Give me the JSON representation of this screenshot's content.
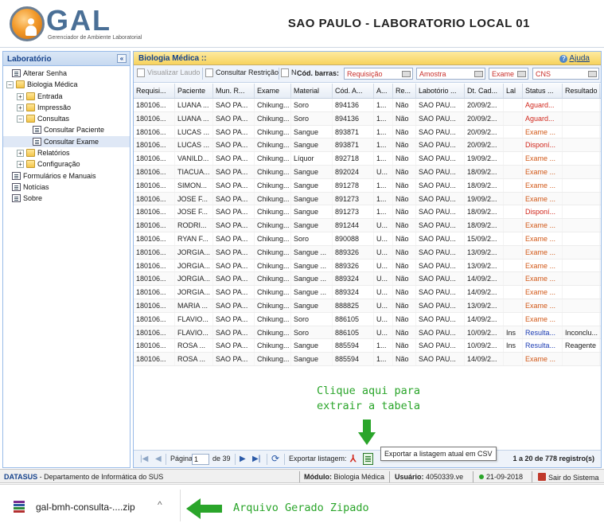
{
  "header": {
    "logo_text": "GAL",
    "logo_subtitle": "Gerenciador de Ambiente Laboratorial",
    "lab_title": "SAO PAULO - LABORATORIO LOCAL 01"
  },
  "sidebar": {
    "title": "Laboratório",
    "collapse_glyph": "«",
    "items": [
      {
        "label": "Alterar Senha",
        "icon": "document-icon",
        "level": 0,
        "expand": ""
      },
      {
        "label": "Biologia Médica",
        "icon": "folder-open-icon",
        "level": 0,
        "expand": "−"
      },
      {
        "label": "Entrada",
        "icon": "folder-icon",
        "level": 1,
        "expand": "+"
      },
      {
        "label": "Impressão",
        "icon": "folder-icon",
        "level": 1,
        "expand": "+"
      },
      {
        "label": "Consultas",
        "icon": "folder-open-icon",
        "level": 1,
        "expand": "−"
      },
      {
        "label": "Consultar Paciente",
        "icon": "document-icon",
        "level": 2,
        "expand": ""
      },
      {
        "label": "Consultar Exame",
        "icon": "document-icon",
        "level": 2,
        "expand": "",
        "selected": true
      },
      {
        "label": "Relatórios",
        "icon": "folder-icon",
        "level": 1,
        "expand": "+"
      },
      {
        "label": "Configuração",
        "icon": "folder-icon",
        "level": 1,
        "expand": "+"
      },
      {
        "label": "Formulários e Manuais",
        "icon": "document-icon",
        "level": 0,
        "expand": ""
      },
      {
        "label": "Notícias",
        "icon": "document-icon",
        "level": 0,
        "expand": ""
      },
      {
        "label": "Sobre",
        "icon": "document-icon",
        "level": 0,
        "expand": ""
      }
    ]
  },
  "main": {
    "title": "Biologia Médica ::",
    "help_label": "Ajuda",
    "help_glyph": "?",
    "toolbar": {
      "visualizar_laudo": "Visualizar Laudo",
      "consultar_restricao": "Consultar Restrição",
      "n_label": "N",
      "barcode_label": "Cód. barras:",
      "requisicao_placeholder": "Requisição",
      "amostra_placeholder": "Amostra",
      "exame_placeholder": "Exame",
      "cns_placeholder": "CNS"
    },
    "columns": [
      "Requisi...",
      "Paciente",
      "Mun. R...",
      "Exame",
      "Material",
      "Cód. A...",
      "A...",
      "Re...",
      "Labotório ...",
      "Dt. Cad...",
      "Lal",
      "Status ...",
      "Resultado"
    ],
    "rows": [
      [
        "180106...",
        "LUANA ...",
        "SAO PA...",
        "Chikung...",
        "Soro",
        "894136",
        "1...",
        "Não",
        "SAO PAU...",
        "20/09/2...",
        "",
        "Aguard...",
        "",
        "red"
      ],
      [
        "180106...",
        "LUANA ...",
        "SAO PA...",
        "Chikung...",
        "Soro",
        "894136",
        "1...",
        "Não",
        "SAO PAU...",
        "20/09/2...",
        "",
        "Aguard...",
        "",
        "red"
      ],
      [
        "180106...",
        "LUCAS ...",
        "SAO PA...",
        "Chikung...",
        "Sangue",
        "893871",
        "1...",
        "Não",
        "SAO PAU...",
        "20/09/2...",
        "",
        "Exame ...",
        "",
        "orange"
      ],
      [
        "180106...",
        "LUCAS ...",
        "SAO PA...",
        "Chikung...",
        "Sangue",
        "893871",
        "1...",
        "Não",
        "SAO PAU...",
        "20/09/2...",
        "",
        "Disponí...",
        "",
        "red"
      ],
      [
        "180106...",
        "VANILD...",
        "SAO PA...",
        "Chikung...",
        "Líquor",
        "892718",
        "1...",
        "Não",
        "SAO PAU...",
        "19/09/2...",
        "",
        "Exame ...",
        "",
        "orange"
      ],
      [
        "180106...",
        "TIACUA...",
        "SAO PA...",
        "Chikung...",
        "Sangue",
        "892024",
        "U...",
        "Não",
        "SAO PAU...",
        "18/09/2...",
        "",
        "Exame ...",
        "",
        "orange"
      ],
      [
        "180106...",
        "SIMON...",
        "SAO PA...",
        "Chikung...",
        "Sangue",
        "891278",
        "1...",
        "Não",
        "SAO PAU...",
        "18/09/2...",
        "",
        "Exame ...",
        "",
        "orange"
      ],
      [
        "180106...",
        "JOSE F...",
        "SAO PA...",
        "Chikung...",
        "Sangue",
        "891273",
        "1...",
        "Não",
        "SAO PAU...",
        "19/09/2...",
        "",
        "Exame ...",
        "",
        "orange"
      ],
      [
        "180106...",
        "JOSE F...",
        "SAO PA...",
        "Chikung...",
        "Sangue",
        "891273",
        "1...",
        "Não",
        "SAO PAU...",
        "18/09/2...",
        "",
        "Disponí...",
        "",
        "red"
      ],
      [
        "180106...",
        "RODRI...",
        "SAO PA...",
        "Chikung...",
        "Sangue",
        "891244",
        "U...",
        "Não",
        "SAO PAU...",
        "18/09/2...",
        "",
        "Exame ...",
        "",
        "orange"
      ],
      [
        "180106...",
        "RYAN F...",
        "SAO PA...",
        "Chikung...",
        "Soro",
        "890088",
        "U...",
        "Não",
        "SAO PAU...",
        "15/09/2...",
        "",
        "Exame ...",
        "",
        "orange"
      ],
      [
        "180106...",
        "JORGIA...",
        "SAO PA...",
        "Chikung...",
        "Sangue ...",
        "889326",
        "U...",
        "Não",
        "SAO PAU...",
        "13/09/2...",
        "",
        "Exame ...",
        "",
        "orange"
      ],
      [
        "180106...",
        "JORGIA...",
        "SAO PA...",
        "Chikung...",
        "Sangue ...",
        "889326",
        "U...",
        "Não",
        "SAO PAU...",
        "13/09/2...",
        "",
        "Exame ...",
        "",
        "orange"
      ],
      [
        "180106...",
        "JORGIA...",
        "SAO PA...",
        "Chikung...",
        "Sangue ...",
        "889324",
        "U...",
        "Não",
        "SAO PAU...",
        "14/09/2...",
        "",
        "Exame ...",
        "",
        "orange"
      ],
      [
        "180106...",
        "JORGIA...",
        "SAO PA...",
        "Chikung...",
        "Sangue ...",
        "889324",
        "U...",
        "Não",
        "SAO PAU...",
        "14/09/2...",
        "",
        "Exame ...",
        "",
        "orange"
      ],
      [
        "180106...",
        "MARIA ...",
        "SAO PA...",
        "Chikung...",
        "Sangue",
        "888825",
        "U...",
        "Não",
        "SAO PAU...",
        "13/09/2...",
        "",
        "Exame ...",
        "",
        "orange"
      ],
      [
        "180106...",
        "FLAVIO...",
        "SAO PA...",
        "Chikung...",
        "Soro",
        "886105",
        "U...",
        "Não",
        "SAO PAU...",
        "14/09/2...",
        "",
        "Exame ...",
        "",
        "orange"
      ],
      [
        "180106...",
        "FLAVIO...",
        "SAO PA...",
        "Chikung...",
        "Soro",
        "886105",
        "U...",
        "Não",
        "SAO PAU...",
        "10/09/2...",
        "Ins",
        "Resulta...",
        "Inconclu...",
        "blue"
      ],
      [
        "180106...",
        "ROSA ...",
        "SAO PA...",
        "Chikung...",
        "Sangue",
        "885594",
        "1...",
        "Não",
        "SAO PAU...",
        "10/09/2...",
        "Ins",
        "Resulta...",
        "Reagente",
        "blue"
      ],
      [
        "180106...",
        "ROSA ...",
        "SAO PA...",
        "Chikung...",
        "Sangue",
        "885594",
        "1...",
        "Não",
        "SAO PAU...",
        "14/09/2...",
        "",
        "Exame ...",
        "",
        "orange"
      ]
    ],
    "annotation": "Clique aqui para\nextrair a tabela",
    "pager": {
      "first_glyph": "|◀",
      "prev_glyph": "◀",
      "next_glyph": "▶",
      "last_glyph": "▶|",
      "refresh_glyph": "⟳",
      "page_label": "Página",
      "page_value": "1",
      "of_label": "de 39",
      "export_label": "Exportar listagem:",
      "pdf_glyph": "⅄",
      "tooltip": "Exportar a listagem atual em CSV",
      "range_text": "1 a 20 de 778 registro(s)"
    }
  },
  "statusbar": {
    "datasus": "DATASUS",
    "department": " - Departamento de Informática do SUS",
    "modulo_label": "Módulo:",
    "modulo_value": "Biologia Médica",
    "usuario_label": "Usuário:",
    "usuario_value": "4050339.ve",
    "date": "21-09-2018",
    "exit": "Sair do Sistema"
  },
  "download": {
    "filename": "gal-bmh-consulta-....zip",
    "chevron": "^",
    "annotation": "Arquivo Gerado Zipado"
  },
  "colors": {
    "status_red": "#d1271c",
    "status_orange": "#d25a1a",
    "status_blue": "#1f3fb4",
    "annotation_green": "#2aa52a"
  }
}
